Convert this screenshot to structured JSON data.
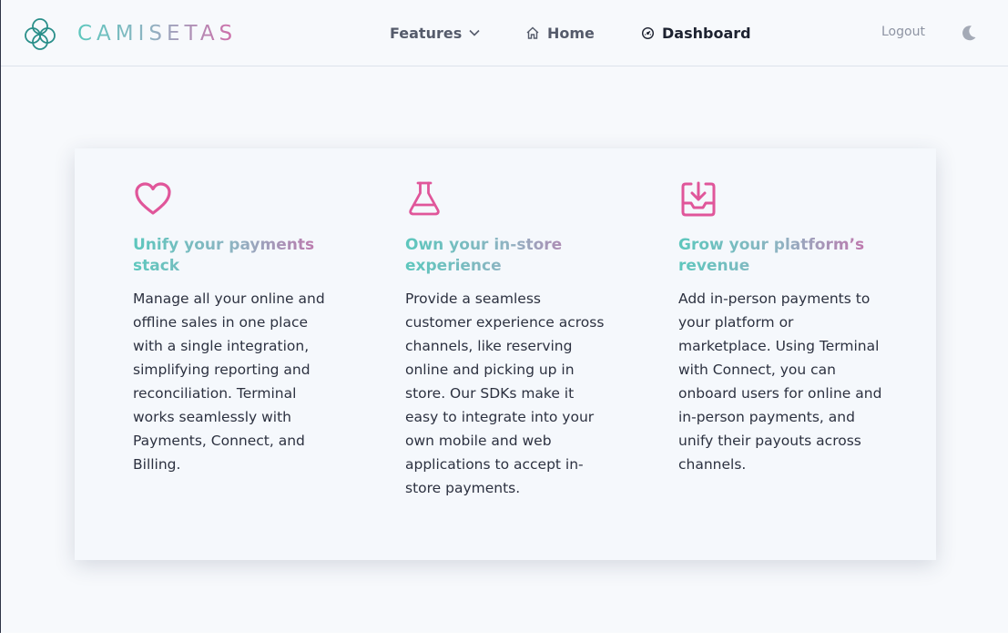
{
  "brand": {
    "name": "CAMISETAS",
    "logo_icon": "flower-logo-icon"
  },
  "nav": {
    "features": {
      "label": "Features",
      "icon": "chevron-down-icon"
    },
    "home": {
      "label": "Home",
      "icon": "home-icon"
    },
    "dashboard": {
      "label": "Dashboard",
      "icon": "gauge-icon"
    },
    "logout": {
      "label": "Logout"
    },
    "theme_toggle": {
      "icon": "moon-icon"
    }
  },
  "features": [
    {
      "icon": "heart-icon",
      "title": "Unify your payments stack",
      "description": "Manage all your online and offline sales in one place with a single integration, simplifying reporting and reconciliation. Terminal works seamlessly with Payments, Connect, and Billing."
    },
    {
      "icon": "flask-icon",
      "title": "Own your in-store experience",
      "description": "Provide a seamless customer experience across channels, like reserving online and picking up in store. Our SDKs make it easy to integrate into your own mobile and web applications to accept in-store payments."
    },
    {
      "icon": "inbox-download-icon",
      "title": "Grow your platform’s revenue",
      "description": "Add in-person payments to your platform or marketplace. Using Terminal with Connect, you can onboard users for online and in-person payments, and unify their payouts across channels."
    }
  ],
  "colors": {
    "accent_teal": "#5cc7bd",
    "accent_pink": "#e0569a",
    "background": "#f7f9fc"
  }
}
